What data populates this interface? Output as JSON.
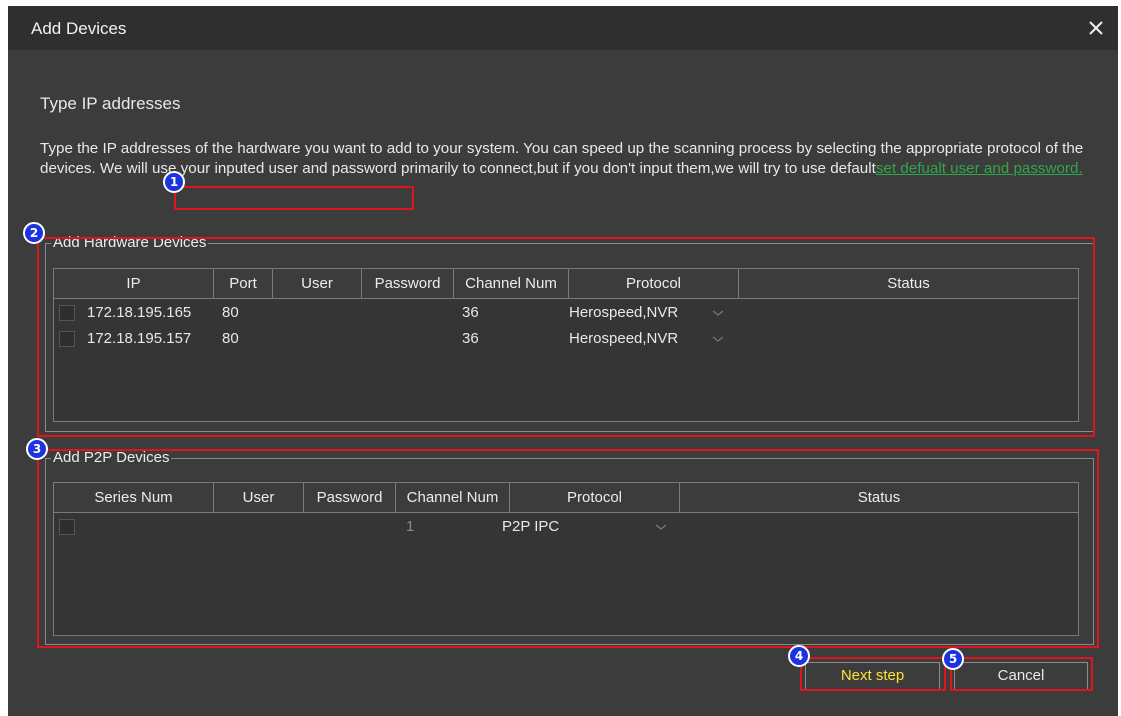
{
  "dialog": {
    "title": "Add Devices",
    "close_icon": "close-icon"
  },
  "section_title": "Type IP addresses",
  "description": {
    "text": "Type the IP addresses of the hardware you want to add to your system. You can speed up the scanning process by selecting the appropriate protocol of the devices. We will use your inputed user and password primarily to connect,but if you don't input them,we will try to use default",
    "link": "set defualt user and password."
  },
  "hardware": {
    "legend": "Add Hardware Devices",
    "columns": [
      "IP",
      "Port",
      "User",
      "Password",
      "Channel Num",
      "Protocol",
      "Status"
    ],
    "rows": [
      {
        "ip": "172.18.195.165",
        "port": "80",
        "user": "",
        "password": "",
        "channels": "36",
        "protocol": "Herospeed,NVR",
        "status": ""
      },
      {
        "ip": "172.18.195.157",
        "port": "80",
        "user": "",
        "password": "",
        "channels": "36",
        "protocol": "Herospeed,NVR",
        "status": ""
      }
    ]
  },
  "p2p": {
    "legend": "Add P2P Devices",
    "columns": [
      "Series Num",
      "User",
      "Password",
      "Channel Num",
      "Protocol",
      "Status"
    ],
    "rows": [
      {
        "series": "",
        "user": "",
        "password": "",
        "channels": "1",
        "protocol": "P2P IPC",
        "status": ""
      }
    ]
  },
  "buttons": {
    "next": "Next step",
    "cancel": "Cancel"
  },
  "annotations": [
    "1",
    "2",
    "3",
    "4",
    "5"
  ],
  "colors": {
    "background": "#3c3c3c",
    "link": "#2ea84a",
    "primary_button_text": "#ffe23a",
    "annotation_box": "#e0141c",
    "annotation_badge": "#1b33e0"
  }
}
